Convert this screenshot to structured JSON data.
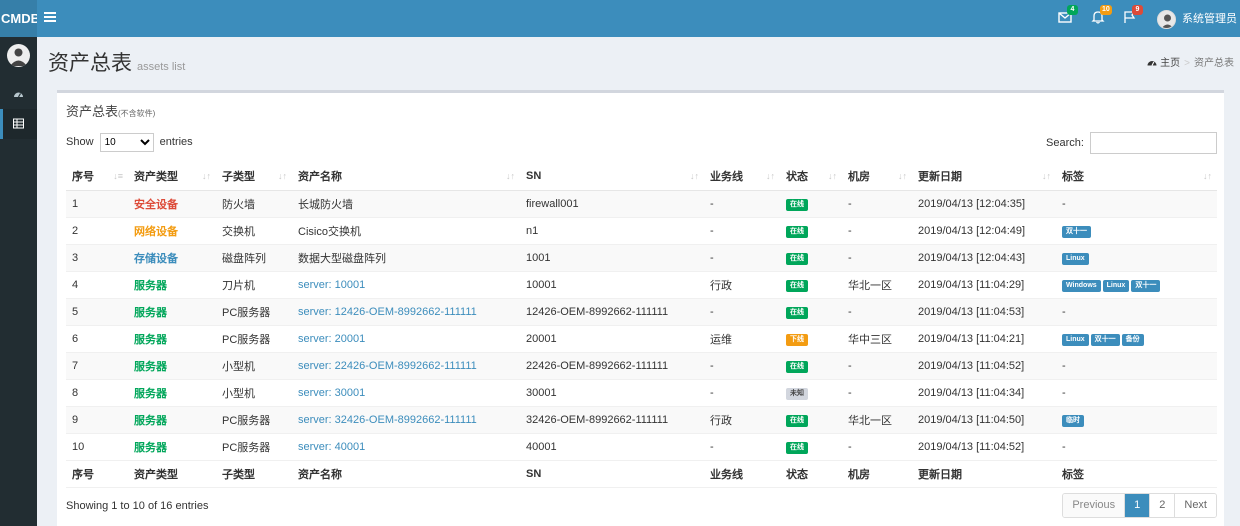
{
  "app": {
    "logo": "CMDB",
    "user_name": "系统管理员"
  },
  "header": {
    "badges": {
      "mail": "4",
      "bell": "10",
      "flag": "9"
    },
    "colors": {
      "mail": "#00a65a",
      "bell": "#f39c12",
      "flag": "#dd4b39"
    }
  },
  "page": {
    "title": "资产总表",
    "subtitle": "assets list"
  },
  "breadcrumb": {
    "home": "主页",
    "current": "资产总表"
  },
  "box": {
    "title": "资产总表",
    "title_note": "(不含软件)"
  },
  "controls": {
    "show": "Show",
    "entries_value": "10",
    "entries": "entries",
    "search_label": "Search:",
    "search_value": ""
  },
  "table": {
    "columns": [
      "序号",
      "资产类型",
      "子类型",
      "资产名称",
      "SN",
      "业务线",
      "状态",
      "机房",
      "更新日期",
      "标签"
    ],
    "rows": [
      {
        "id": "1",
        "type": "安全设备",
        "type_class": "t-security",
        "subtype": "防火墙",
        "name": "长城防火墙",
        "link": false,
        "sn": "firewall001",
        "biz": "-",
        "status": "在线",
        "status_class": "lbl-green",
        "room": "-",
        "date": "2019/04/13 [12:04:35]",
        "tags": []
      },
      {
        "id": "2",
        "type": "网络设备",
        "type_class": "t-network",
        "subtype": "交换机",
        "name": "Cisico交换机",
        "link": false,
        "sn": "n1",
        "biz": "-",
        "status": "在线",
        "status_class": "lbl-green",
        "room": "-",
        "date": "2019/04/13 [12:04:49]",
        "tags": [
          "双十一"
        ]
      },
      {
        "id": "3",
        "type": "存储设备",
        "type_class": "t-storage",
        "subtype": "磁盘阵列",
        "name": "数据大型磁盘阵列",
        "link": false,
        "sn": "1001",
        "biz": "-",
        "status": "在线",
        "status_class": "lbl-green",
        "room": "-",
        "date": "2019/04/13 [12:04:43]",
        "tags": [
          "Linux"
        ]
      },
      {
        "id": "4",
        "type": "服务器",
        "type_class": "t-server",
        "subtype": "刀片机",
        "name": "server: 10001",
        "link": true,
        "sn": "10001",
        "biz": "行政",
        "status": "在线",
        "status_class": "lbl-green",
        "room": "华北一区",
        "date": "2019/04/13 [11:04:29]",
        "tags": [
          "Windows",
          "Linux",
          "双十一"
        ]
      },
      {
        "id": "5",
        "type": "服务器",
        "type_class": "t-server",
        "subtype": "PC服务器",
        "name": "server: 12426-OEM-8992662-111111",
        "link": true,
        "sn": "12426-OEM-8992662-111111",
        "biz": "-",
        "status": "在线",
        "status_class": "lbl-green",
        "room": "-",
        "date": "2019/04/13 [11:04:53]",
        "tags": []
      },
      {
        "id": "6",
        "type": "服务器",
        "type_class": "t-server",
        "subtype": "PC服务器",
        "name": "server: 20001",
        "link": true,
        "sn": "20001",
        "biz": "运维",
        "status": "下线",
        "status_class": "lbl-orange",
        "room": "华中三区",
        "date": "2019/04/13 [11:04:21]",
        "tags": [
          "Linux",
          "双十一",
          "备份"
        ]
      },
      {
        "id": "7",
        "type": "服务器",
        "type_class": "t-server",
        "subtype": "小型机",
        "name": "server: 22426-OEM-8992662-111111",
        "link": true,
        "sn": "22426-OEM-8992662-111111",
        "biz": "-",
        "status": "在线",
        "status_class": "lbl-green",
        "room": "-",
        "date": "2019/04/13 [11:04:52]",
        "tags": []
      },
      {
        "id": "8",
        "type": "服务器",
        "type_class": "t-server",
        "subtype": "小型机",
        "name": "server: 30001",
        "link": true,
        "sn": "30001",
        "biz": "-",
        "status": "未知",
        "status_class": "lbl-gray",
        "room": "-",
        "date": "2019/04/13 [11:04:34]",
        "tags": []
      },
      {
        "id": "9",
        "type": "服务器",
        "type_class": "t-server",
        "subtype": "PC服务器",
        "name": "server: 32426-OEM-8992662-111111",
        "link": true,
        "sn": "32426-OEM-8992662-111111",
        "biz": "行政",
        "status": "在线",
        "status_class": "lbl-green",
        "room": "华北一区",
        "date": "2019/04/13 [11:04:50]",
        "tags": [
          "临时"
        ]
      },
      {
        "id": "10",
        "type": "服务器",
        "type_class": "t-server",
        "subtype": "PC服务器",
        "name": "server: 40001",
        "link": true,
        "sn": "40001",
        "biz": "-",
        "status": "在线",
        "status_class": "lbl-green",
        "room": "-",
        "date": "2019/04/13 [11:04:52]",
        "tags": []
      }
    ],
    "empty_tag": "-"
  },
  "footer": {
    "info": "Showing 1 to 10 of 16 entries",
    "prev": "Previous",
    "pages": [
      "1",
      "2"
    ],
    "active_page": "1",
    "next": "Next"
  }
}
